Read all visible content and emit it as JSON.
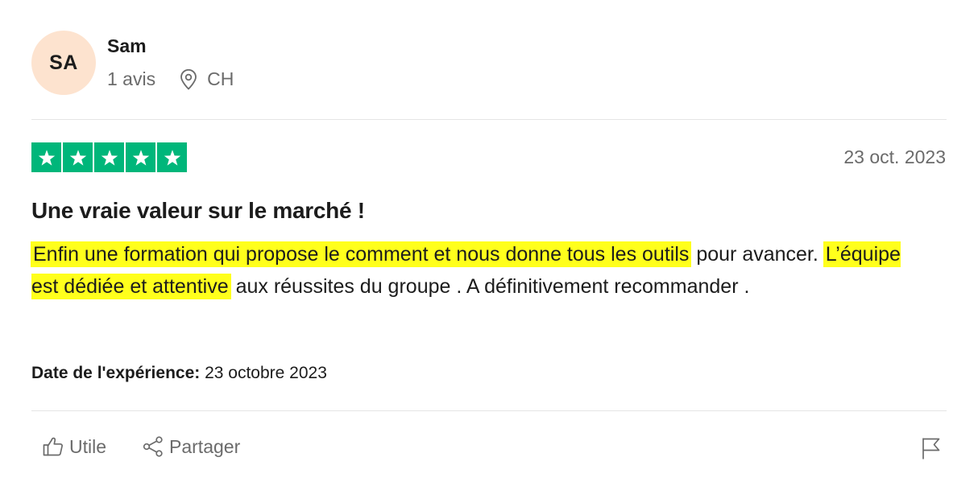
{
  "user": {
    "initials": "SA",
    "name": "Sam",
    "review_count": "1 avis",
    "country": "CH",
    "avatar_color": "#fde3cf"
  },
  "rating": {
    "stars": 5,
    "max": 5,
    "star_color": "#00b67a",
    "date": "23 oct. 2023"
  },
  "review": {
    "title": "Une vraie valeur sur le marché !",
    "body": {
      "part1_highlight": "Enfin une formation qui propose le comment et nous donne tous les outils",
      "part2": " pour avancer. ",
      "part3_highlight": "L’équipe est dédiée et attentive",
      "part4": " aux réussites du groupe . A définitivement recommander ."
    },
    "highlight_color": "#ffff1c",
    "experience_label": "Date de l'expérience:",
    "experience_date": " 23 octobre 2023"
  },
  "actions": {
    "useful_label": "Utile",
    "share_label": "Partager",
    "useful_icon": "thumbs-up-icon",
    "share_icon": "share-icon",
    "report_icon": "flag-icon"
  }
}
